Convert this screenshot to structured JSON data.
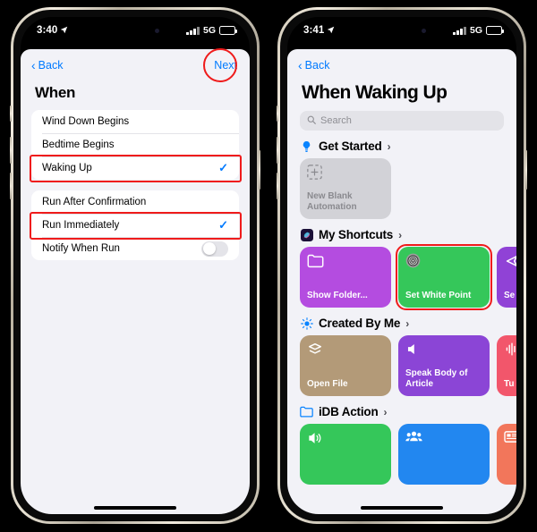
{
  "phones": {
    "left": {
      "status_bar": {
        "time": "3:40",
        "location_icon": "location-arrow-icon",
        "network": "5G",
        "battery_icon": "battery-icon"
      },
      "nav": {
        "back_label": "Back",
        "next_label": "Next"
      },
      "section_title": "When",
      "highlight_color": "#ef1b1b",
      "accent_color": "#007aff",
      "groups": [
        {
          "rows": [
            {
              "label": "Wind Down Begins",
              "checked": false,
              "highlighted": false
            },
            {
              "label": "Bedtime Begins",
              "checked": false,
              "highlighted": false
            },
            {
              "label": "Waking Up",
              "checked": true,
              "highlighted": true
            }
          ]
        },
        {
          "rows": [
            {
              "label": "Run After Confirmation",
              "checked": false,
              "highlighted": false
            },
            {
              "label": "Run Immediately",
              "checked": true,
              "highlighted": true
            },
            {
              "label": "Notify When Run",
              "toggle": true,
              "toggle_on": false,
              "highlighted": false
            }
          ]
        }
      ]
    },
    "right": {
      "status_bar": {
        "time": "3:41",
        "location_icon": "location-arrow-icon",
        "network": "5G",
        "battery_icon": "battery-icon"
      },
      "nav": {
        "back_label": "Back"
      },
      "title": "When Waking Up",
      "search": {
        "placeholder": "Search",
        "icon": "search-icon"
      },
      "sections": [
        {
          "label": "Get Started",
          "icon": "lightbulb-icon",
          "chevron": "›",
          "tiles": [
            {
              "label": "New Blank Automation",
              "color": "#d2d2d7",
              "icon": "add-dashed-square-icon",
              "blank": true,
              "highlighted": false
            }
          ]
        },
        {
          "label": "My Shortcuts",
          "icon": "shortcuts-app-icon",
          "chevron": "›",
          "tiles": [
            {
              "label": "Show Folder...",
              "color": "#b44ce0",
              "icon": "folder-icon",
              "highlighted": false
            },
            {
              "label": "Set White Point",
              "color": "#35c75a",
              "icon": "dial-target-icon",
              "highlighted": true
            },
            {
              "label": "Se Ph",
              "color": "#9042d6",
              "icon": "share-icon",
              "highlighted": false
            }
          ]
        },
        {
          "label": "Created By Me",
          "icon": "brightness-icon",
          "chevron": "›",
          "tiles": [
            {
              "label": "Open File",
              "color": "#b39a78",
              "icon": "layers-icon",
              "highlighted": false
            },
            {
              "label": "Speak Body of Article",
              "color": "#8b45d6",
              "icon": "speaker-icon",
              "highlighted": false
            },
            {
              "label": "Tu Int",
              "color": "#f2566b",
              "icon": "waveform-icon",
              "highlighted": false
            }
          ]
        },
        {
          "label": "iDB Action",
          "icon": "folder-blue-icon",
          "chevron": "›",
          "tiles": [
            {
              "label": "",
              "color": "#35c75a",
              "icon": "volume-icon",
              "highlighted": false
            },
            {
              "label": "",
              "color": "#2287f0",
              "icon": "people-icon",
              "highlighted": false
            },
            {
              "label": "",
              "color": "#f2765b",
              "icon": "news-icon",
              "highlighted": false
            }
          ]
        }
      ]
    }
  }
}
